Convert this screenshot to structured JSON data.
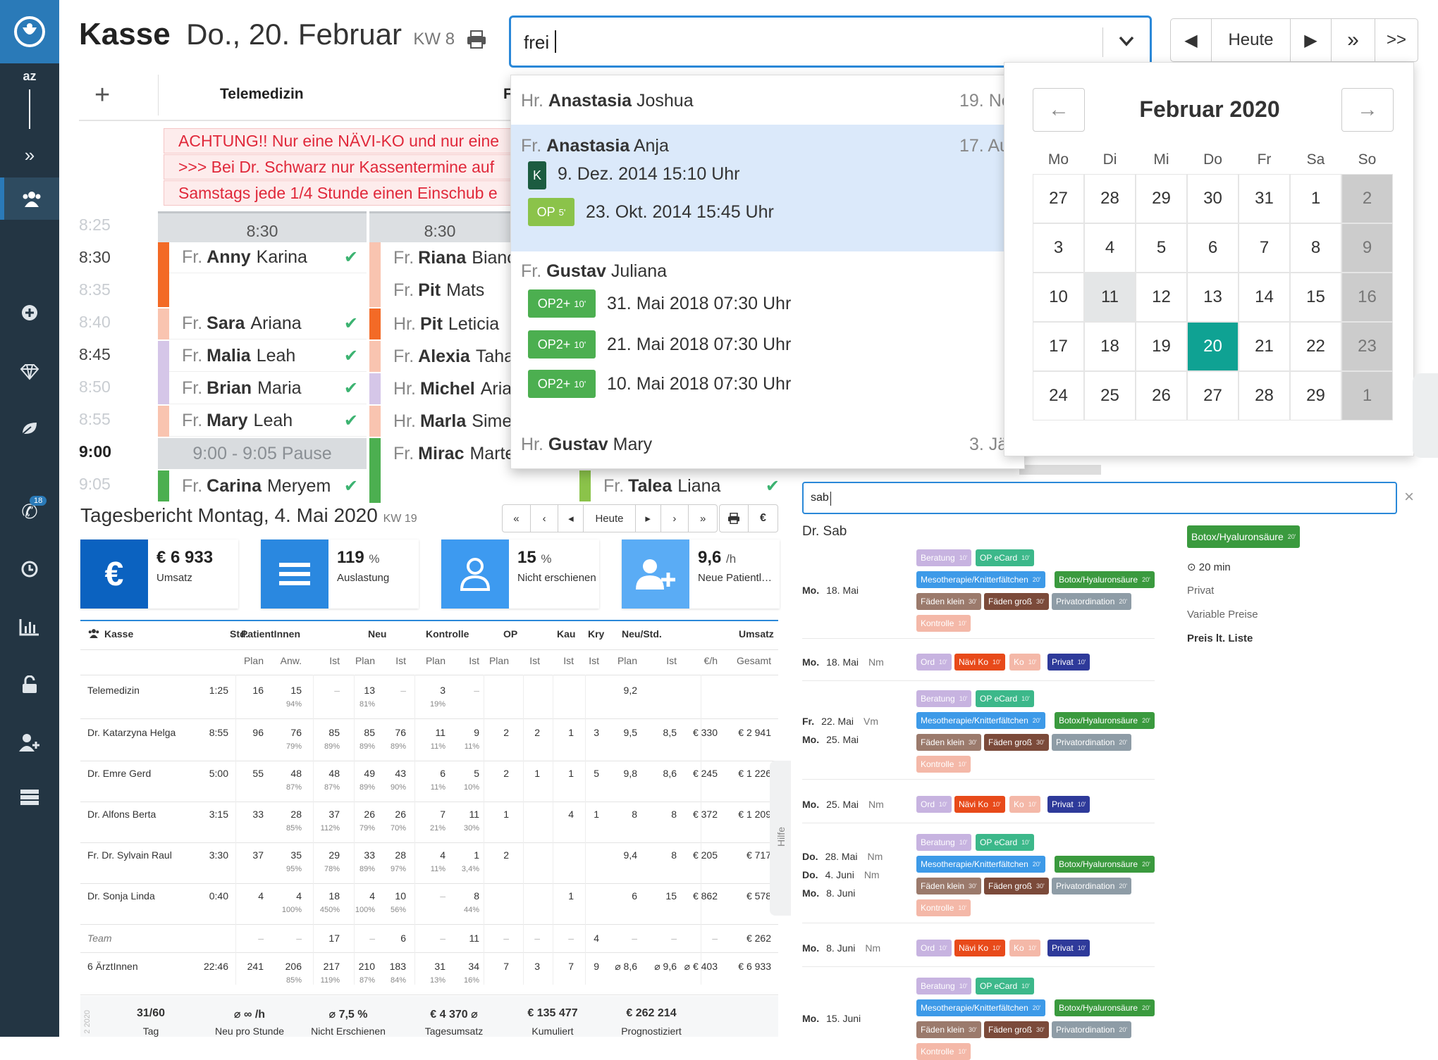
{
  "sidebar": {
    "az_label": "az",
    "phone_badge": "18",
    "items": [
      "logo-icon",
      "az",
      "collapse-icon",
      "users-icon",
      "plus-circle-icon",
      "diamond-icon",
      "leaf-icon",
      "phone-icon",
      "clock-icon",
      "bar-chart-icon",
      "lock-icon",
      "user-plus-icon",
      "server-icon"
    ]
  },
  "header": {
    "title": "Kasse",
    "date": "Do., 20. Februar",
    "kw": "KW 8",
    "search_value": "frei",
    "nav": [
      "◀",
      "Heute",
      "▶",
      "»",
      ">>"
    ]
  },
  "schedule": {
    "tab_label": "Telemedizin",
    "alerts": [
      "ACHTUNG!! Nur eine NÄVI-KO und nur eine",
      ">>> Bei Dr. Schwarz nur Kassentermine auf",
      "Samstags jede 1/4 Stunde einen Einschub e"
    ],
    "col_headers": [
      "8:30",
      "8:30"
    ],
    "times": [
      "8:25",
      "8:30",
      "8:35",
      "8:40",
      "8:45",
      "8:50",
      "8:55",
      "9:00",
      "9:05"
    ],
    "pause_label": "9:00 - 9:05 Pause",
    "col1": [
      {
        "pre": "Fr.",
        "last": "Anny",
        "first": "Karina"
      },
      {
        "pre": "Fr.",
        "last": "Sara",
        "first": "Ariana"
      },
      {
        "pre": "Fr.",
        "last": "Malia",
        "first": "Leah"
      },
      {
        "pre": "Fr.",
        "last": "Brian",
        "first": "Maria"
      },
      {
        "pre": "Fr.",
        "last": "Mary",
        "first": "Leah"
      },
      {
        "pre": "Fr.",
        "last": "Carina",
        "first": "Meryem"
      }
    ],
    "col2": [
      {
        "pre": "Fr.",
        "last": "Riana",
        "first": "Bianca"
      },
      {
        "pre": "Fr.",
        "last": "Pit",
        "first": "Mats"
      },
      {
        "pre": "Hr.",
        "last": "Pit",
        "first": "Leticia"
      },
      {
        "pre": "Fr.",
        "last": "Alexia",
        "first": "Taha"
      },
      {
        "pre": "Hr.",
        "last": "Michel",
        "first": "Ariana"
      },
      {
        "pre": "Hr.",
        "last": "Marla",
        "first": "Simeo"
      },
      {
        "pre": "Fr.",
        "last": "Mirac",
        "first": "Marten"
      }
    ],
    "col3_last": {
      "pre": "Fr.",
      "last": "Talea",
      "first": "Liana"
    },
    "checkmark": "✔",
    "col2_cut_header": "F"
  },
  "dropdown": {
    "items": [
      {
        "pre": "Hr.",
        "last": "Anastasia",
        "first": "Joshua",
        "date": "19. No"
      },
      {
        "pre": "Fr.",
        "last": "Anastasia",
        "first": "Anja",
        "date": "17. Au"
      },
      {
        "pre": "Fr.",
        "last": "Gustav",
        "first": "Juliana",
        "date": ""
      },
      {
        "pre": "Hr.",
        "last": "Gustav",
        "first": "Mary",
        "date": "3. Jä"
      }
    ],
    "appointments": [
      {
        "tag": "K",
        "dur": "",
        "text": "9. Dez. 2014 15:10 Uhr"
      },
      {
        "tag": "OP",
        "dur": "5'",
        "text": "23. Okt. 2014 15:45 Uhr"
      },
      {
        "tag": "OP2+",
        "dur": "10'",
        "text": "31. Mai 2018 07:30 Uhr"
      },
      {
        "tag": "OP2+",
        "dur": "10'",
        "text": "21. Mai 2018 07:30 Uhr"
      },
      {
        "tag": "OP2+",
        "dur": "10'",
        "text": "10. Mai 2018 07:30 Uhr"
      }
    ]
  },
  "calendar": {
    "month": "Februar 2020",
    "prev": "←",
    "next": "→",
    "weekdays": [
      "Mo",
      "Di",
      "Mi",
      "Do",
      "Fr",
      "Sa",
      "So"
    ],
    "weeks": [
      [
        "27",
        "28",
        "29",
        "30",
        "31",
        "1",
        "2"
      ],
      [
        "3",
        "4",
        "5",
        "6",
        "7",
        "8",
        "9"
      ],
      [
        "10",
        "11",
        "12",
        "13",
        "14",
        "15",
        "16"
      ],
      [
        "17",
        "18",
        "19",
        "20",
        "21",
        "22",
        "23"
      ],
      [
        "24",
        "25",
        "26",
        "27",
        "28",
        "29",
        "1"
      ]
    ],
    "selected": "20",
    "colors": {
      "selected": "#0fa293",
      "weekend": "#cccccc",
      "today": "#e4e6e7"
    }
  },
  "report": {
    "title": "Tagesbericht Montag, 4. Mai 2020",
    "kw": "KW 19",
    "nav": [
      "«",
      "‹",
      "◂",
      "Heute",
      "▸",
      "›",
      "»"
    ],
    "tools": [
      "print-icon",
      "€"
    ],
    "stats": [
      {
        "value": "€ 6 933",
        "unit": "",
        "label": "Umsatz",
        "icon": "euro-icon",
        "color": "#0b62c0"
      },
      {
        "value": "119",
        "unit": "%",
        "label": "Auslastung",
        "icon": "list-icon",
        "color": "#2a88e0"
      },
      {
        "value": "15",
        "unit": "%",
        "label": "Nicht erschienen",
        "icon": "user-icon",
        "color": "#3d9af0"
      },
      {
        "value": "9,6",
        "unit": "/h",
        "label": "Neue Patientl…",
        "icon": "user-plus-icon",
        "color": "#5aacf5"
      }
    ],
    "headers": [
      "Kasse",
      "Std.",
      "PatientInnen",
      "Neu",
      "Kontrolle",
      "OP",
      "Kau",
      "Kry",
      "Neu/Std.",
      "Umsatz"
    ],
    "subheaders": [
      "Plan",
      "Anw.",
      "Ist",
      "Plan",
      "Ist",
      "Plan",
      "Ist",
      "Plan",
      "Ist",
      "Ist",
      "Ist",
      "Plan",
      "Ist",
      "€/h",
      "Gesamt"
    ],
    "rows": [
      {
        "name": "Telemedizin",
        "std": "1:25",
        "cells": [
          "16",
          "15",
          "–",
          "13",
          "–",
          "3",
          "–",
          "",
          "",
          "",
          "",
          "9,2",
          "",
          "",
          ""
        ],
        "pcts": [
          "",
          "94%",
          "",
          "81%",
          "",
          "19%",
          "",
          "",
          "",
          "",
          "",
          "",
          "",
          "",
          ""
        ]
      },
      {
        "name": "Dr. Katarzyna Helga",
        "std": "8:55",
        "cells": [
          "96",
          "76",
          "85",
          "85",
          "76",
          "11",
          "9",
          "2",
          "2",
          "1",
          "3",
          "9,5",
          "8,5",
          "€ 330",
          "€ 2 941"
        ],
        "pcts": [
          "",
          "79%",
          "89%",
          "89%",
          "89%",
          "11%",
          "11%",
          "",
          "",
          "",
          "",
          "",
          "",
          "",
          ""
        ]
      },
      {
        "name": "Dr. Emre Gerd",
        "std": "5:00",
        "cells": [
          "55",
          "48",
          "48",
          "49",
          "43",
          "6",
          "5",
          "2",
          "1",
          "1",
          "5",
          "9,8",
          "8,6",
          "€ 245",
          "€ 1 226"
        ],
        "pcts": [
          "",
          "87%",
          "87%",
          "89%",
          "90%",
          "11%",
          "10%",
          "",
          "",
          "",
          "",
          "",
          "",
          "",
          ""
        ]
      },
      {
        "name": "Dr. Alfons Berta",
        "std": "3:15",
        "cells": [
          "33",
          "28",
          "37",
          "26",
          "26",
          "7",
          "11",
          "1",
          "",
          "4",
          "1",
          "8",
          "8",
          "€ 372",
          "€ 1 209"
        ],
        "pcts": [
          "",
          "85%",
          "112%",
          "79%",
          "70%",
          "21%",
          "30%",
          "",
          "",
          "",
          "",
          "",
          "",
          "",
          ""
        ]
      },
      {
        "name": "Fr. Dr. Sylvain Raul",
        "std": "3:30",
        "cells": [
          "37",
          "35",
          "29",
          "33",
          "28",
          "4",
          "1",
          "2",
          "",
          "",
          "",
          "9,4",
          "8",
          "€ 205",
          "€ 717"
        ],
        "pcts": [
          "",
          "95%",
          "78%",
          "89%",
          "97%",
          "11%",
          "3,4%",
          "",
          "",
          "",
          "",
          "",
          "",
          "",
          ""
        ]
      },
      {
        "name": "Dr. Sonja Linda",
        "std": "0:40",
        "cells": [
          "4",
          "4",
          "18",
          "4",
          "10",
          "–",
          "8",
          "",
          "",
          "1",
          "",
          "6",
          "15",
          "€ 862",
          "€ 578"
        ],
        "pcts": [
          "",
          "100%",
          "450%",
          "100%",
          "56%",
          "",
          "44%",
          "",
          "",
          "",
          "",
          "",
          "",
          "",
          ""
        ]
      },
      {
        "name": "Team",
        "std": "",
        "cells": [
          "–",
          "–",
          "17",
          "–",
          "6",
          "–",
          "11",
          "–",
          "–",
          "–",
          "4",
          "–",
          "–",
          "–",
          "€ 262"
        ],
        "pcts": [
          "",
          "",
          "",
          "",
          "",
          "",
          "",
          "",
          "",
          "",
          "",
          "",
          "",
          "",
          ""
        ]
      },
      {
        "name": "6 ÄrztInnen",
        "std": "22:46",
        "cells": [
          "241",
          "206",
          "217",
          "210",
          "183",
          "31",
          "34",
          "7",
          "3",
          "7",
          "9",
          "⌀ 8,6",
          "⌀ 9,6",
          "⌀ € 403",
          "€ 6 933"
        ],
        "pcts": [
          "",
          "85%",
          "119%",
          "87%",
          "84%",
          "13%",
          "16%",
          "",
          "",
          "",
          "",
          "",
          "",
          "",
          ""
        ]
      }
    ],
    "footer": [
      {
        "v": "31/60",
        "l": "Tag"
      },
      {
        "v": "⌀ ∞ /h",
        "l": "Neu pro Stunde"
      },
      {
        "v": "⌀ 7,5 %",
        "l": "Nicht Erschienen"
      },
      {
        "v": "€ 4 370 ⌀",
        "l": "Tagesumsatz"
      },
      {
        "v": "€ 135 477",
        "l": "Kumuliert"
      },
      {
        "v": "€ 262 214",
        "l": "Prognostiziert"
      }
    ],
    "footer_side": "2 2020"
  },
  "right": {
    "search_value": "sab",
    "close": "×",
    "doctor": "Dr. Sab",
    "help": "Hilfe",
    "detail": {
      "tag": "Botox/Hyaluronsäure",
      "dur": "20'",
      "duration": "20 min",
      "lines": [
        "Privat",
        "Variable Preise"
      ],
      "price": "Preis lt. Liste"
    },
    "groups": [
      {
        "days": [
          {
            "wd": "Mo.",
            "d": "18. Mai",
            "s": ""
          }
        ],
        "type": "full"
      },
      {
        "days": [
          {
            "wd": "Mo.",
            "d": "18. Mai",
            "s": "Nm"
          }
        ],
        "type": "short"
      },
      {
        "days": [
          {
            "wd": "Fr.",
            "d": "22. Mai",
            "s": "Vm"
          },
          {
            "wd": "Mo.",
            "d": "25. Mai",
            "s": ""
          }
        ],
        "type": "full"
      },
      {
        "days": [
          {
            "wd": "Mo.",
            "d": "25. Mai",
            "s": "Nm"
          }
        ],
        "type": "short"
      },
      {
        "days": [
          {
            "wd": "Do.",
            "d": "28. Mai",
            "s": "Nm"
          },
          {
            "wd": "Do.",
            "d": "4. Juni",
            "s": "Nm"
          },
          {
            "wd": "Mo.",
            "d": "8. Juni",
            "s": ""
          }
        ],
        "type": "full"
      },
      {
        "days": [
          {
            "wd": "Mo.",
            "d": "8. Juni",
            "s": "Nm"
          }
        ],
        "type": "short"
      },
      {
        "days": [
          {
            "wd": "Mo.",
            "d": "15. Juni",
            "s": ""
          }
        ],
        "type": "full"
      }
    ],
    "full_pills": [
      [
        {
          "t": "Beratung",
          "d": "10'",
          "c": "#c7b3e0"
        },
        {
          "t": "OP eCard",
          "d": "10'",
          "c": "#3cb88a"
        }
      ],
      [
        {
          "t": "Mesotherapie/Knitterfältchen",
          "d": "20'",
          "c": "#3d9ae8"
        },
        {
          "t": "Botox/Hyaluronsäure",
          "d": "20'",
          "c": "#3a9a3e"
        }
      ],
      [
        {
          "t": "Fäden klein",
          "d": "30'",
          "c": "#9b7a6c"
        },
        {
          "t": "Fäden groß",
          "d": "30'",
          "c": "#7b4a3a"
        },
        {
          "t": "Privatordination",
          "d": "20'",
          "c": "#8e9ca6"
        }
      ],
      [
        {
          "t": "Kontrolle",
          "d": "10'",
          "c": "#f4b8a8"
        }
      ]
    ],
    "short_pills": [
      {
        "t": "Ord",
        "d": "10'",
        "c": "#c7b3e0"
      },
      {
        "t": "Nävi Ko",
        "d": "10'",
        "c": "#e84a1a"
      },
      {
        "t": "Ko",
        "d": "10'",
        "c": "#f4b8a8"
      },
      {
        "t": "Privat",
        "d": "10'",
        "c": "#2e3a9a"
      }
    ]
  }
}
